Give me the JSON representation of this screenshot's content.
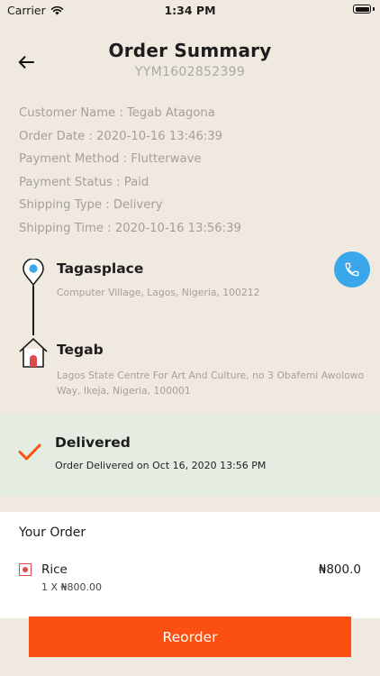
{
  "status_bar": {
    "carrier": "Carrier",
    "time": "1:34 PM",
    "icons": [
      "wifi-icon",
      "battery-icon"
    ]
  },
  "header": {
    "back_icon": "arrow-left-icon",
    "title": "Order Summary",
    "order_number": "YYM1602852399"
  },
  "info": [
    "Customer Name : Tegab Atagona",
    "Order Date : 2020-10-16 13:46:39",
    "Payment Method :  Flutterwave",
    "Payment Status : Paid",
    "Shipping Type : Delivery",
    "Shipping Time : 2020-10-16 13:56:39"
  ],
  "route": {
    "pickup": {
      "icon": "location-pin-icon",
      "name": "Tagasplace",
      "address": "Computer Village, Lagos, Nigeria, 100212"
    },
    "dropoff": {
      "icon": "house-icon",
      "name": "Tegab",
      "address": "Lagos State Centre For Art And Culture, no 3 Obafemi Awolowo Way, Ikeja, Nigeria, 100001"
    },
    "call_icon": "phone-icon"
  },
  "delivery": {
    "icon": "checkmark-icon",
    "status": "Delivered",
    "detail": "Order Delivered on Oct 16, 2020 13:56 PM"
  },
  "order": {
    "heading": "Your Order",
    "items": [
      {
        "name": "Rice",
        "quantity_text": "1 X ₦800.00",
        "price": "₦800.0"
      }
    ]
  },
  "actions": {
    "reorder_label": "Reorder"
  },
  "colors": {
    "background": "#efe9df",
    "accent": "#fb5012",
    "call_button": "#3aa7ea",
    "delivered_panel": "#e5ede3",
    "item_marker": "#e0474f"
  }
}
